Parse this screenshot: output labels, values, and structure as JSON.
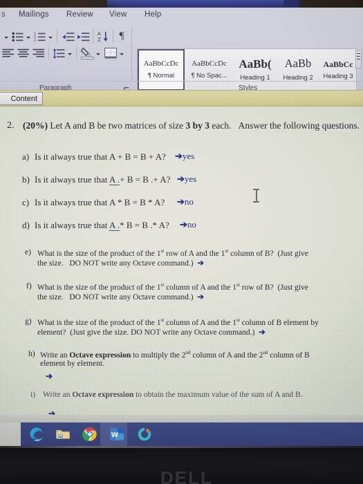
{
  "app": {
    "name": "Microsoft Word",
    "ribbon_tabs": [
      {
        "label": "s",
        "partial": true
      },
      {
        "label": "Mailings",
        "partial": false
      },
      {
        "label": "Review",
        "partial": false
      },
      {
        "label": "View",
        "partial": false
      },
      {
        "label": "Help",
        "partial": false
      }
    ],
    "groups": {
      "paragraph_label": "Paragraph",
      "styles_label": "Styles"
    },
    "paragraph_buttons": [
      {
        "name": "bullets-button",
        "title": "Bullets"
      },
      {
        "name": "numbering-button",
        "title": "Numbering"
      },
      {
        "name": "multilevel-list-button",
        "title": "Multilevel List"
      },
      {
        "name": "decrease-indent-button",
        "title": "Decrease Indent"
      },
      {
        "name": "increase-indent-button",
        "title": "Increase Indent"
      },
      {
        "name": "sort-button",
        "title": "Sort"
      },
      {
        "name": "show-formatting-marks-button",
        "title": "Show/Hide Formatting Marks"
      },
      {
        "name": "align-left-button",
        "title": "Align Left"
      },
      {
        "name": "align-center-button",
        "title": "Center"
      },
      {
        "name": "align-right-button",
        "title": "Align Right"
      },
      {
        "name": "line-spacing-button",
        "title": "Line and Paragraph Spacing"
      },
      {
        "name": "shading-button",
        "title": "Shading"
      },
      {
        "name": "borders-button",
        "title": "Borders"
      }
    ],
    "styles": [
      {
        "preview": "AaBbCcDc",
        "name": "¶ Normal",
        "selected": true,
        "size": 11,
        "weight": "normal",
        "spellmark": true
      },
      {
        "preview": "AaBbCcDc",
        "name": "¶ No Spac...",
        "selected": false,
        "size": 11,
        "weight": "normal",
        "spellmark": false
      },
      {
        "preview": "AaBb(",
        "name": "Heading 1",
        "selected": false,
        "size": 17,
        "weight": "bold",
        "spellmark": false
      },
      {
        "preview": "AaBb",
        "name": "Heading 2",
        "selected": false,
        "size": 16,
        "weight": "normal",
        "spellmark": false
      },
      {
        "preview": "AaBbCc",
        "name": "Heading 3",
        "selected": false,
        "size": 12,
        "weight": "bold",
        "spellmark": false
      }
    ],
    "message_bar": {
      "button_label": "Content",
      "full_label": "Enable Content",
      "bg_color": "#d9d39c"
    }
  },
  "document": {
    "question_number": "2.",
    "percent": "(20%)",
    "stem": " Let A and B be two matrices of size ",
    "stem_size": "3 by 3",
    "stem_tail": " each.",
    "stem_instruction": "Answer the following questions.",
    "items": [
      {
        "letter": "a)",
        "line1_a": "Is it always true that A + B = B + A?",
        "answer": "yes",
        "arrow": "➔"
      },
      {
        "letter": "b)",
        "line1_a": "Is it always true that ",
        "underlined": "A .",
        "line1_b": "+ B = B .+ A?",
        "answer": "yes",
        "arrow": "➔"
      },
      {
        "letter": "c)",
        "line1_a": "Is it always true that A * B = B * A?",
        "answer": "no",
        "arrow": "➔"
      },
      {
        "letter": "d)",
        "line1_a": "Is it always true that ",
        "underlined": "A .",
        "line1_b": "* B = B .* A?",
        "answer": "no",
        "arrow": "➔"
      }
    ],
    "items2": [
      {
        "letter": "e)",
        "l1_p1": "What is the size of the product of the 1",
        "l1_o1": "st",
        "l1_p2": " row of A and the 1",
        "l1_o2": "st",
        "l1_p3": " column of B?",
        "l1_p4": "(Just give",
        "l2_p1": "the size.",
        "l2_p2": "DO NOT write any Octave command.)",
        "arrow": "➔"
      },
      {
        "letter": "f)",
        "l1_p1": "What is the size of the product of the 1",
        "l1_o1": "st",
        "l1_p2": " column of A and the 1",
        "l1_o2": "st",
        "l1_p3": " row of B?",
        "l1_p4": "(Just give",
        "l2_p1": "the size.",
        "l2_p2": "DO NOT write any Octave command.)",
        "arrow": "➔"
      },
      {
        "letter": "g)",
        "l1_p1": "What is the size of the product of the 1",
        "l1_o1": "st",
        "l1_p2": " column of A and the 1",
        "l1_o2": "st",
        "l1_p3": " column of B element by",
        "l1_p4": "",
        "l2_p1": "element?",
        "l2_p2": "(Just give the size.    DO NOT write any Octave command.)",
        "arrow": "➔"
      }
    ],
    "items3": [
      {
        "letter": "h)",
        "l1_p1": "Write an ",
        "l1_bold": "Octave expression",
        "l1_p2": " to multiply the 2",
        "l1_o1": "nd",
        "l1_p3": " column of A and the 2",
        "l1_o2": "nd",
        "l1_p4": " column of B",
        "l2": "element by element.",
        "arrow": "➔"
      },
      {
        "letter": "i)",
        "l1_p1": "Write an ",
        "l1_bold": "Octave expression",
        "l1_p2": " to obtain the maximum value of the sum of A and B.",
        "l1_o1": "",
        "l1_p3": "",
        "l1_o2": "",
        "l1_p4": "",
        "l2": "",
        "arrow": "➔"
      }
    ]
  },
  "taskbar": {
    "items": [
      {
        "name": "edge-icon",
        "label": "Microsoft Edge",
        "active": false
      },
      {
        "name": "file-explorer-icon",
        "label": "File Explorer",
        "active": false
      },
      {
        "name": "chrome-icon",
        "label": "Google Chrome",
        "active": false
      },
      {
        "name": "word-icon",
        "label": "Microsoft Word",
        "active": true
      },
      {
        "name": "app-icon",
        "label": "App",
        "active": false
      }
    ],
    "bg_color": "#3a4680"
  },
  "monitor": {
    "brand": "DELL"
  },
  "colors": {
    "accent_blue": "#1b2f86",
    "warning_bar": "#d9d39c",
    "taskbar": "#3a4680",
    "ribbon": "#d4d5e1"
  }
}
